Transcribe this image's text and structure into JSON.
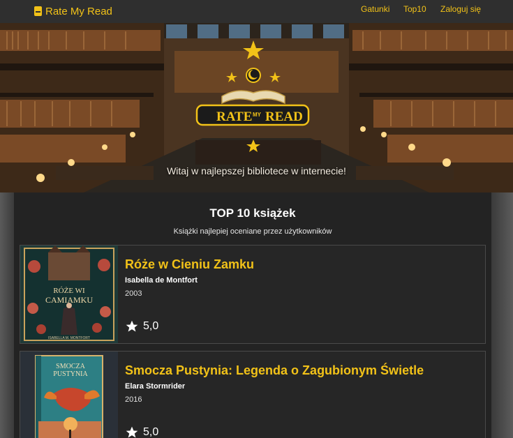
{
  "navbar": {
    "brand": "Rate My Read",
    "links": [
      "Gatunki",
      "Top10",
      "Zaloguj się"
    ]
  },
  "hero": {
    "logo_text_1": "RATE",
    "logo_text_2": "MY",
    "logo_text_3": "READ",
    "caption": "Witaj w najlepszej bibliotece w internecie!"
  },
  "main": {
    "title": "TOP 10 książek",
    "subtitle": "Książki najlepiej oceniane przez użytkowników",
    "books": [
      {
        "title": "Róże w Cieniu Zamku",
        "author": "Isabella de Montfort",
        "year": "2003",
        "rating": "5,0",
        "cover_title": "RÓŻE WI CAMIAMKU",
        "cover_author": "ISABELLA M. MONTFORT"
      },
      {
        "title": "Smocza Pustynia: Legenda o Zagubionym Świetle",
        "author": "Elara Stormrider",
        "year": "2016",
        "rating": "5,0",
        "cover_title": "SMOCZA PUSTYNIA"
      }
    ]
  },
  "colors": {
    "accent": "#f2c218",
    "navbar_bg": "#2f2f2f",
    "card_bg": "#262626"
  }
}
